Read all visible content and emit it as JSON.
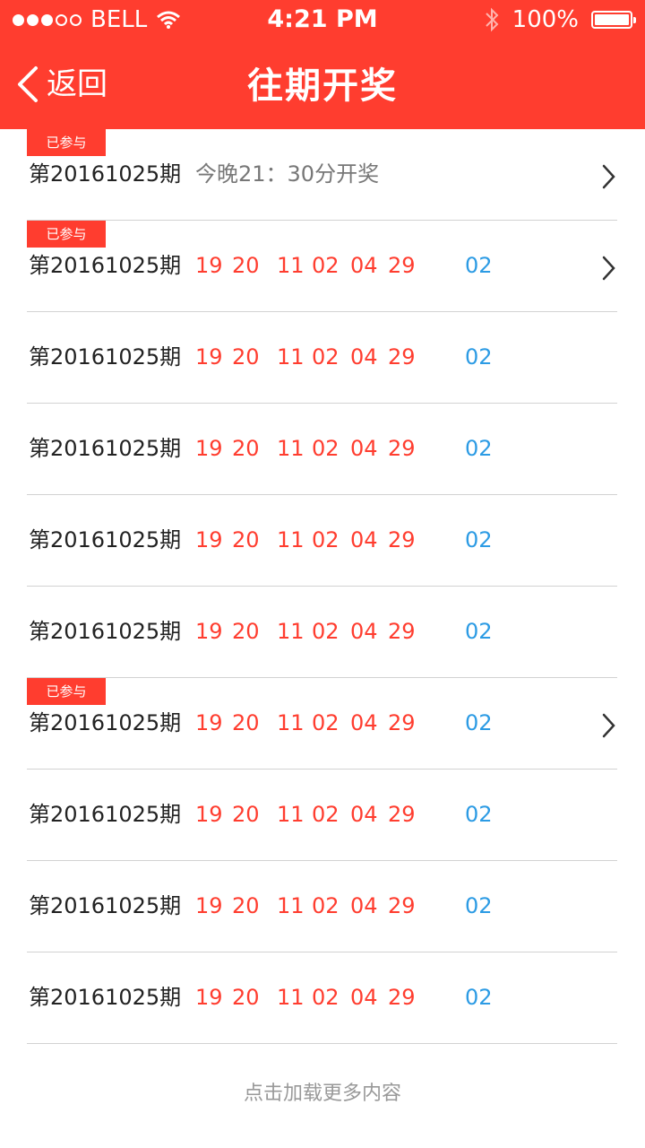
{
  "status_bar": {
    "carrier": "BELL",
    "time": "4:21 PM",
    "battery": "100%"
  },
  "nav": {
    "back_label": "返回",
    "title": "往期开奖"
  },
  "badge_label": "已参与",
  "rows": [
    {
      "issue": "第20161025期",
      "participated": true,
      "chevron": true,
      "pending_text": "今晚21：30分开奖"
    },
    {
      "issue": "第20161025期",
      "participated": true,
      "chevron": true,
      "red": [
        "19",
        "20",
        "11",
        "02",
        "04",
        "29"
      ],
      "blue": "02"
    },
    {
      "issue": "第20161025期",
      "participated": false,
      "chevron": false,
      "red": [
        "19",
        "20",
        "11",
        "02",
        "04",
        "29"
      ],
      "blue": "02"
    },
    {
      "issue": "第20161025期",
      "participated": false,
      "chevron": false,
      "red": [
        "19",
        "20",
        "11",
        "02",
        "04",
        "29"
      ],
      "blue": "02"
    },
    {
      "issue": "第20161025期",
      "participated": false,
      "chevron": false,
      "red": [
        "19",
        "20",
        "11",
        "02",
        "04",
        "29"
      ],
      "blue": "02"
    },
    {
      "issue": "第20161025期",
      "participated": false,
      "chevron": false,
      "red": [
        "19",
        "20",
        "11",
        "02",
        "04",
        "29"
      ],
      "blue": "02"
    },
    {
      "issue": "第20161025期",
      "participated": true,
      "chevron": true,
      "red": [
        "19",
        "20",
        "11",
        "02",
        "04",
        "29"
      ],
      "blue": "02"
    },
    {
      "issue": "第20161025期",
      "participated": false,
      "chevron": false,
      "red": [
        "19",
        "20",
        "11",
        "02",
        "04",
        "29"
      ],
      "blue": "02"
    },
    {
      "issue": "第20161025期",
      "participated": false,
      "chevron": false,
      "red": [
        "19",
        "20",
        "11",
        "02",
        "04",
        "29"
      ],
      "blue": "02"
    },
    {
      "issue": "第20161025期",
      "participated": false,
      "chevron": false,
      "red": [
        "19",
        "20",
        "11",
        "02",
        "04",
        "29"
      ],
      "blue": "02"
    }
  ],
  "load_more": "点击加载更多内容",
  "colors": {
    "brand_red": "#ff3d2f",
    "blue_ball": "#2c9be4"
  }
}
